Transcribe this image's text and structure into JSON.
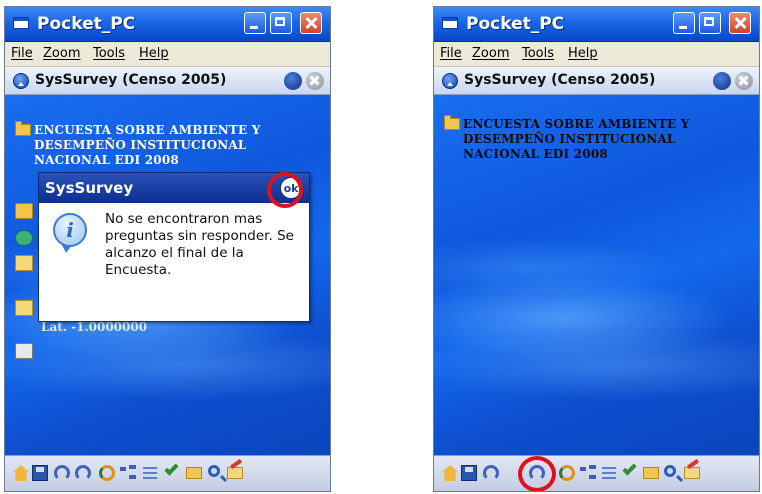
{
  "screens": [
    {
      "window": {
        "title": "Pocket_PC"
      },
      "menu": [
        "File",
        "Zoom",
        "Tools",
        "Help"
      ],
      "app": {
        "title": "SysSurvey (Censo 2005)"
      },
      "survey_item": "ENCUESTA SOBRE AMBIENTE Y DESEMPEÑO INSTITUCIONAL NACIONAL EDI 2008",
      "coord_text": "Lat. -1.0000000",
      "dialog": {
        "title": "SysSurvey",
        "ok_label": "ok",
        "message": "No se encontraron mas preguntas sin responder. Se alcanzo el final de la Encuesta."
      }
    },
    {
      "window": {
        "title": "Pocket_PC"
      },
      "menu": [
        "File",
        "Zoom",
        "Tools",
        "Help"
      ],
      "app": {
        "title": "SysSurvey (Censo 2005)"
      },
      "survey_item": "ENCUESTA SOBRE AMBIENTE Y DESEMPEÑO INSTITUCIONAL NACIONAL EDI 2008"
    }
  ],
  "toolbar_icons": [
    "home-icon",
    "save-icon",
    "undo-icon",
    "redo-icon",
    "sync-icon",
    "tree-icon",
    "list-icon",
    "check-icon",
    "folder-icon",
    "search-icon",
    "mail-icon"
  ],
  "colors": {
    "highlight_ring": "#e0101e",
    "dialog_header": "#0b2f8f",
    "wallpaper": "#1460e6"
  }
}
